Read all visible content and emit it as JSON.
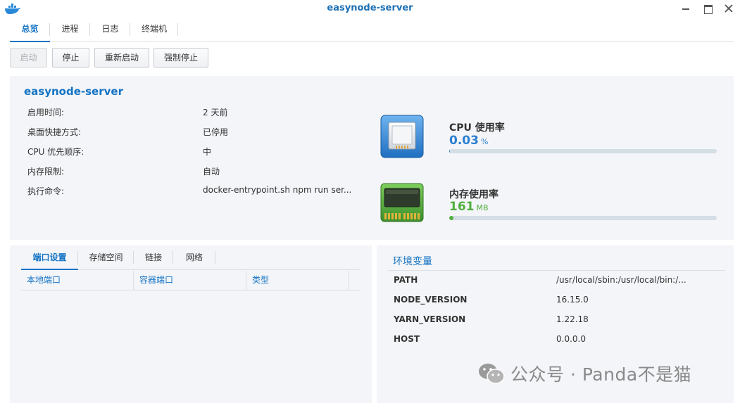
{
  "window": {
    "title": "easynode-server",
    "app_icon": "docker-whale-icon"
  },
  "tabs": [
    {
      "label": "总览",
      "active": true
    },
    {
      "label": "进程",
      "active": false
    },
    {
      "label": "日志",
      "active": false
    },
    {
      "label": "终端机",
      "active": false
    }
  ],
  "toolbar": {
    "start": "启动",
    "stop": "停止",
    "restart": "重新启动",
    "force_stop": "强制停止"
  },
  "summary": {
    "name": "easynode-server",
    "rows": [
      {
        "label": "启用时间:",
        "value": "2 天前"
      },
      {
        "label": "桌面快捷方式:",
        "value": "已停用"
      },
      {
        "label": "CPU 优先顺序:",
        "value": "中"
      },
      {
        "label": "内存限制:",
        "value": "自动"
      },
      {
        "label": "执行命令:",
        "value": "docker-entrypoint.sh npm run ser..."
      }
    ]
  },
  "metrics": {
    "cpu": {
      "label": "CPU 使用率",
      "value": "0.03",
      "unit": "%",
      "percent": 0.03,
      "color": "#2b7fd0",
      "icon": "cpu-chip-icon"
    },
    "memory": {
      "label": "内存使用率",
      "value": "161",
      "unit": "MB",
      "percent": 1.5,
      "color": "#4fae3c",
      "icon": "memory-module-icon"
    }
  },
  "ports_panel": {
    "tabs": [
      {
        "label": "端口设置",
        "active": true
      },
      {
        "label": "存储空间",
        "active": false
      },
      {
        "label": "链接",
        "active": false
      },
      {
        "label": "网络",
        "active": false
      }
    ],
    "columns": [
      "本地端口",
      "容器端口",
      "类型"
    ]
  },
  "env_panel": {
    "title": "环境变量",
    "rows": [
      {
        "name": "PATH",
        "value": "/usr/local/sbin:/usr/local/bin:/..."
      },
      {
        "name": "NODE_VERSION",
        "value": "16.15.0"
      },
      {
        "name": "YARN_VERSION",
        "value": "1.22.18"
      },
      {
        "name": "HOST",
        "value": "0.0.0.0"
      }
    ]
  },
  "watermark": {
    "text": "公众号 · Panda不是猫",
    "icon": "wechat-logo-icon"
  }
}
